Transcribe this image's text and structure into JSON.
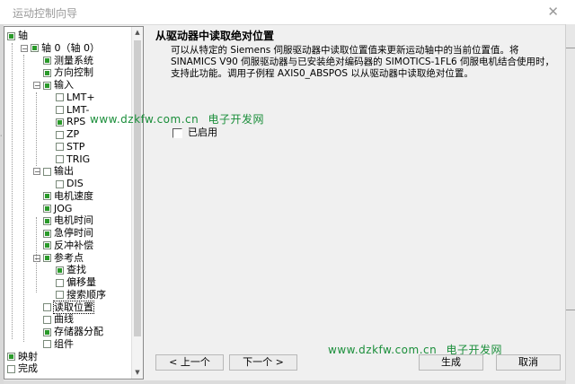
{
  "window": {
    "title": "运动控制向导"
  },
  "tree": {
    "items": [
      {
        "label": "轴",
        "checked": true
      },
      {
        "label": "轴 0（轴 0）",
        "checked": true
      },
      {
        "label": "测量系统",
        "checked": true
      },
      {
        "label": "方向控制",
        "checked": true
      },
      {
        "label": "输入",
        "checked": true
      },
      {
        "label": "LMT+",
        "checked": false
      },
      {
        "label": "LMT-",
        "checked": false
      },
      {
        "label": "RPS",
        "checked": true
      },
      {
        "label": "ZP",
        "checked": false
      },
      {
        "label": "STP",
        "checked": false
      },
      {
        "label": "TRIG",
        "checked": false
      },
      {
        "label": "输出",
        "checked": false
      },
      {
        "label": "DIS",
        "checked": false
      },
      {
        "label": "电机速度",
        "checked": true
      },
      {
        "label": "JOG",
        "checked": true
      },
      {
        "label": "电机时间",
        "checked": true
      },
      {
        "label": "急停时间",
        "checked": true
      },
      {
        "label": "反冲补偿",
        "checked": true
      },
      {
        "label": "参考点",
        "checked": true
      },
      {
        "label": "查找",
        "checked": true
      },
      {
        "label": "偏移量",
        "checked": false
      },
      {
        "label": "搜索顺序",
        "checked": false
      },
      {
        "label": "读取位置",
        "checked": false
      },
      {
        "label": "曲线",
        "checked": false
      },
      {
        "label": "存储器分配",
        "checked": true
      },
      {
        "label": "组件",
        "checked": false
      },
      {
        "label": "映射",
        "checked": true
      },
      {
        "label": "完成",
        "checked": false
      }
    ]
  },
  "content": {
    "title": "从驱动器中读取绝对位置",
    "line1": "可以从特定的 Siemens 伺服驱动器中读取位置值来更新运动轴中的当前位置值。将",
    "line2": "SINAMICS V90 伺服驱动器与已安装绝对编码器的 SIMOTICS-1FL6 伺服电机结合使用时，",
    "line3": "支持此功能。调用子例程 AXIS0_ABSPOS 以从驱动器中读取绝对位置。",
    "enable_label": "已启用"
  },
  "watermark": {
    "site": "www.dzkfw.com.cn",
    "name": "电子开发网"
  },
  "buttons": {
    "prev": "< 上一个",
    "next": "下一个 >",
    "finish": "生成",
    "cancel": "取消"
  },
  "colors": {
    "check": "#2a9a2a",
    "watermark": "#1a8e3a"
  }
}
